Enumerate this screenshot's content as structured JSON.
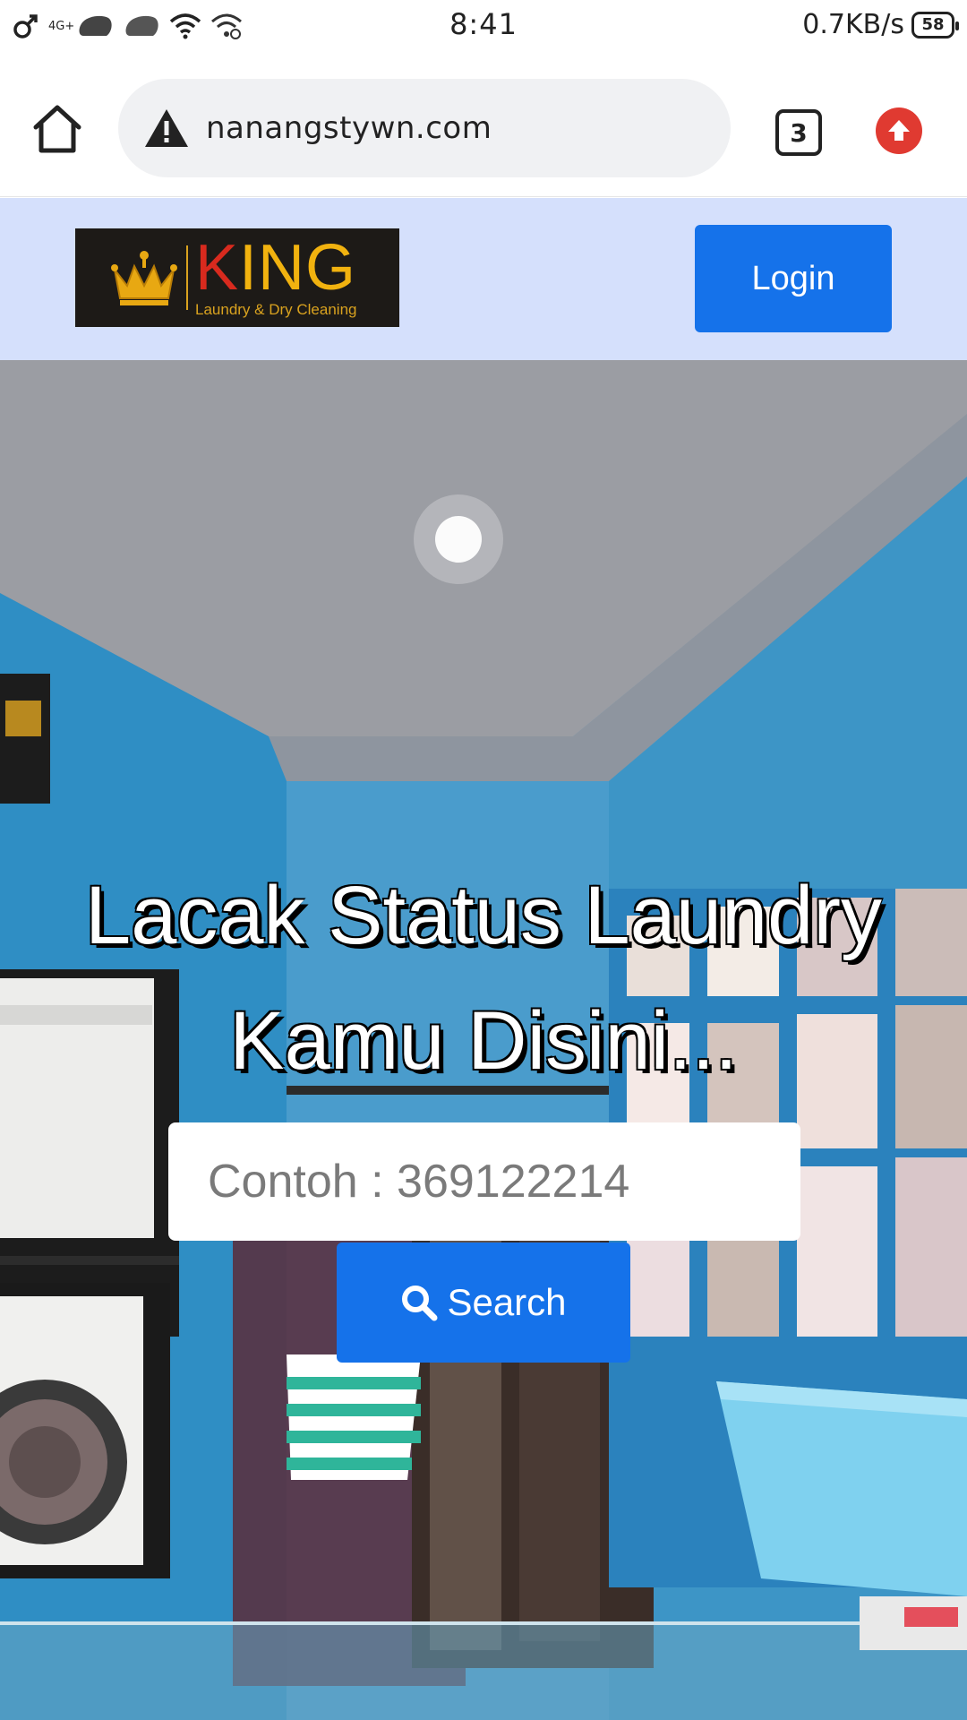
{
  "status_bar": {
    "time": "8:41",
    "network_label": "4G+",
    "data_rate": "0.7KB/s",
    "battery": "58"
  },
  "browser": {
    "url": "nanangstywn.com",
    "tab_count": "3",
    "security_icon": "warning-triangle-icon",
    "home_icon": "home-icon",
    "update_icon": "arrow-up-circle-icon"
  },
  "site": {
    "logo": {
      "name": "KING",
      "subtitle": "Laundry & Dry Cleaning"
    },
    "login_label": "Login",
    "hero_title": "Lacak Status Laundry Kamu Disini...",
    "search": {
      "placeholder": "Contoh : 369122214",
      "button_label": "Search",
      "button_icon": "search-icon"
    }
  },
  "colors": {
    "primary_button": "#1572ea",
    "header_bg": "#d5e0fc",
    "logo_gold": "#f1b20f",
    "logo_red": "#d82a1e",
    "update_badge": "#e03a31"
  }
}
